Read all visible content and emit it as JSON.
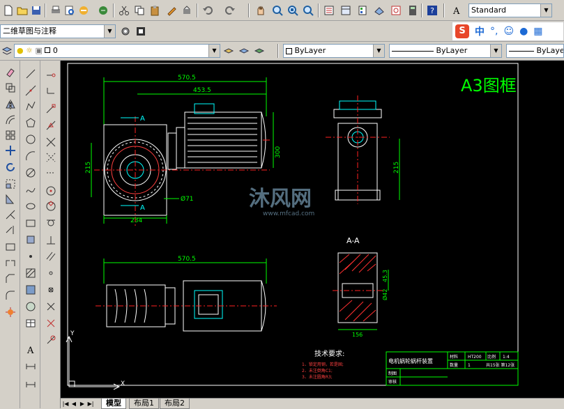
{
  "toolbar": {
    "text_style": "Standard",
    "ime_label": "中"
  },
  "workspace": {
    "selected": "二维草图与注释"
  },
  "layer": {
    "current": "0"
  },
  "properties": {
    "color": "ByLayer",
    "linetype": "ByLayer",
    "lineweight": "ByLayer"
  },
  "drawing": {
    "frame_title": "A3图框",
    "dim_570_top": "570.5",
    "dim_453": "453.5",
    "dim_215_left": "215",
    "dim_234": "234",
    "dim_300": "300",
    "dim_phi71": "Ø71",
    "dim_215_right": "215",
    "section_label": "A-A",
    "dim_570_bottom": "570.5",
    "dim_45": "45.3",
    "dim_phi42": "Ø42",
    "dim_156": "156",
    "arrow_a_top": "A",
    "arrow_a_bottom": "A",
    "tech_title": "技术要求:",
    "tech_line1": "1、锁定用钢，若是固;",
    "tech_line2": "2、未注倒角C1;",
    "tech_line3": "3、未注圆角R3;",
    "watermark_name": "沐风网",
    "watermark_url": "www.mfcad.com",
    "title_name": "电机蜗轮蜗杆装置",
    "title_material_label": "材料",
    "title_material": "HT200",
    "title_scale_label": "比例",
    "title_scale": "1:4",
    "title_qty_label": "数量",
    "title_qty": "1",
    "title_sheets": "共15张 第12张",
    "title_drawn": "制图",
    "title_checked": "审核",
    "axis_y": "Y",
    "axis_x": "X"
  },
  "tabs": [
    "模型",
    "布局1",
    "布局2"
  ],
  "colors": {
    "dimension": "#00ff00",
    "outline": "#ffffff",
    "center": "#ff0000",
    "hatch": "#ff3030",
    "highlight": "#00ffff",
    "title_block": "#00ff00"
  }
}
